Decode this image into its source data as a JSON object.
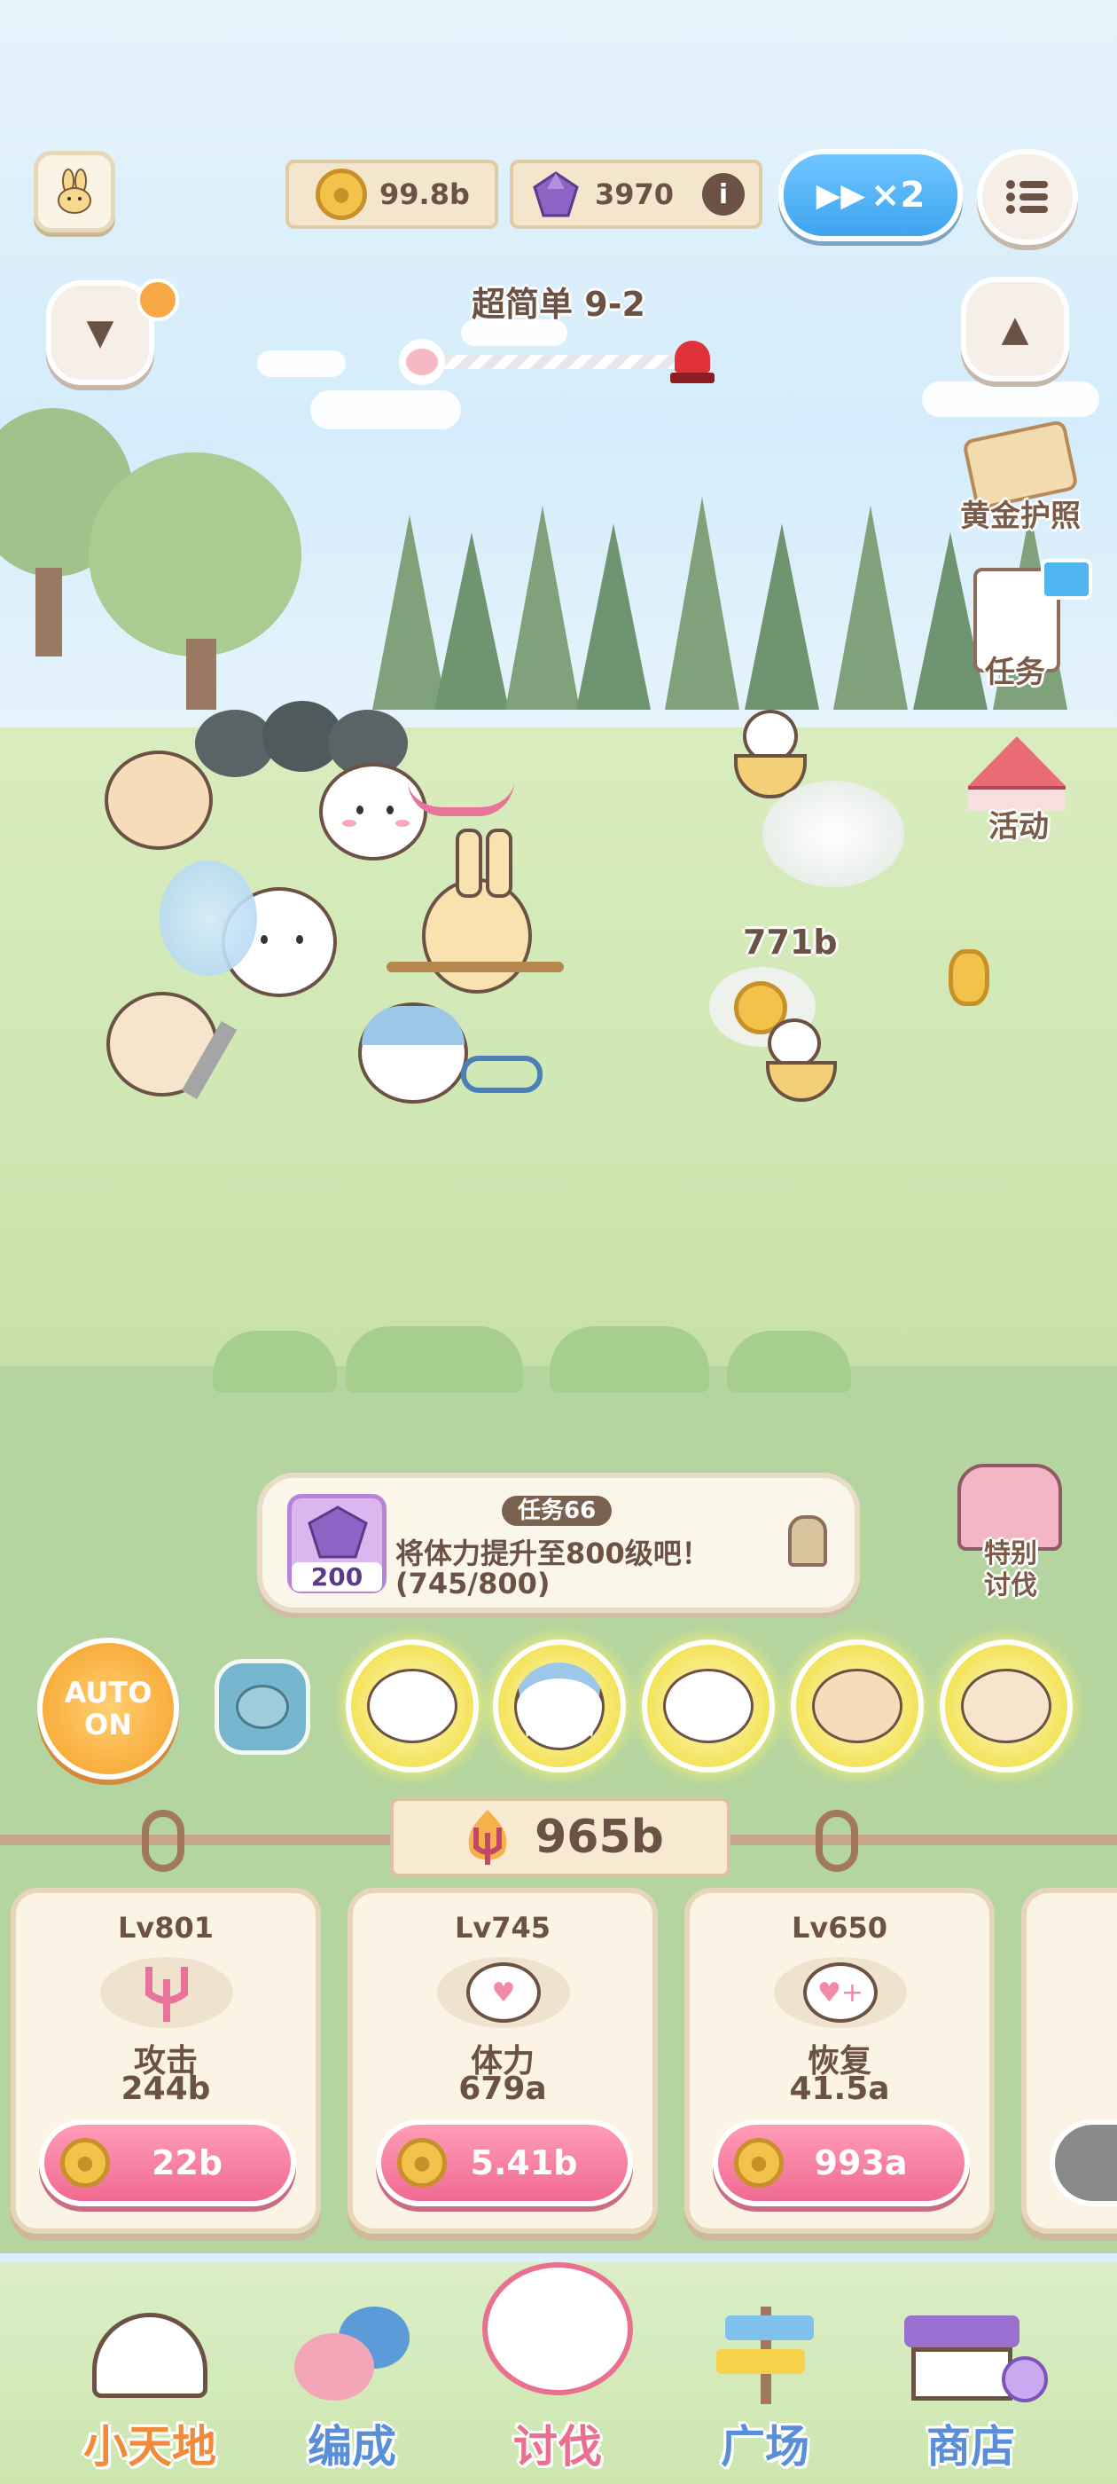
{
  "hud": {
    "coins": "99.8b",
    "gems": "3970",
    "speed": "×2",
    "stage": "超简单 9-2"
  },
  "side_menu": {
    "gold_passport": "黄金护照",
    "missions": "任务",
    "events": "活动",
    "special_hunt": "特别\n讨伐"
  },
  "battle": {
    "damage_text": "771b"
  },
  "quest": {
    "tag": "任务66",
    "reward": "200",
    "text": "将体力提升至800级吧！",
    "progress": "(745/800)"
  },
  "auto": {
    "line1": "AUTO",
    "line2": "ON"
  },
  "power": "965b",
  "upgrades": [
    {
      "level": "Lv801",
      "name": "攻击",
      "value": "244b",
      "cost": "22b"
    },
    {
      "level": "Lv745",
      "name": "体力",
      "value": "679a",
      "cost": "5.41b"
    },
    {
      "level": "Lv650",
      "name": "恢复",
      "value": "41.5a",
      "cost": "993a"
    }
  ],
  "nav": [
    {
      "label": "小天地",
      "icon": "house-icon"
    },
    {
      "label": "编成",
      "icon": "team-icon"
    },
    {
      "label": "讨伐",
      "icon": "hunt-icon"
    },
    {
      "label": "广场",
      "icon": "signpost-icon"
    },
    {
      "label": "商店",
      "icon": "shop-icon"
    }
  ],
  "colors": {
    "accent_pink": "#f06a92",
    "speed_blue": "#3ea4ef",
    "text_brown": "#6b5244",
    "nav_blue": "#5a8fd8",
    "nav_active": "#e9708f"
  }
}
